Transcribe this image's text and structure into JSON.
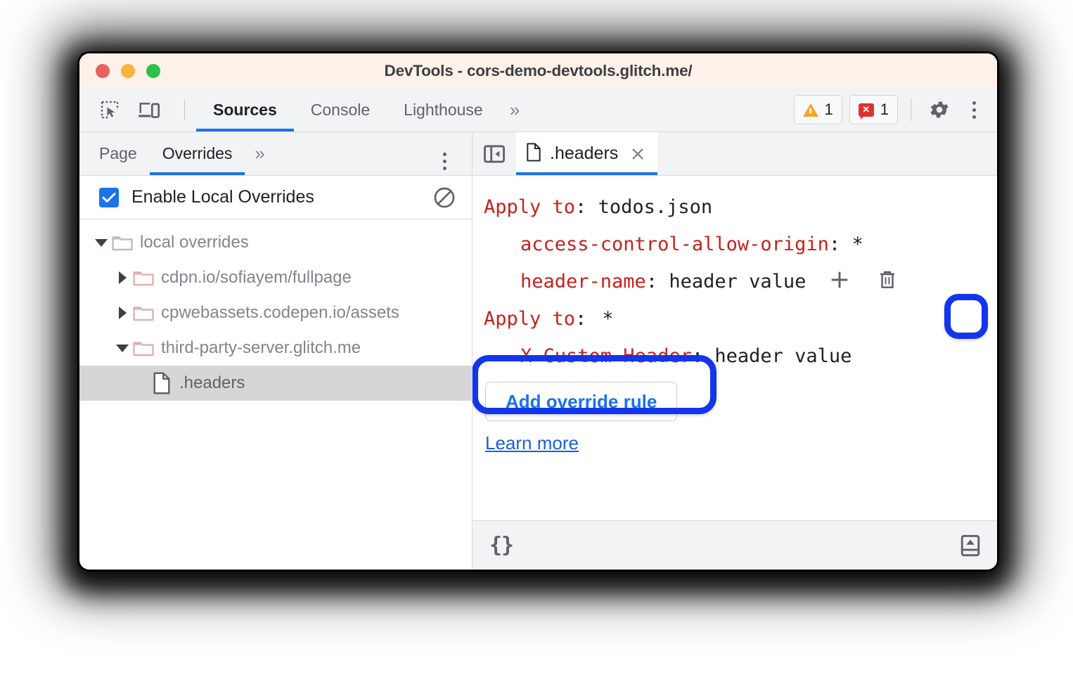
{
  "window": {
    "title": "DevTools - cors-demo-devtools.glitch.me/",
    "traffic_lights": [
      "close",
      "minimize",
      "maximize"
    ],
    "accent": "#1a73e8",
    "annotation_color": "#1335ec",
    "titlebar_color": "#fdf1e9"
  },
  "toolbar": {
    "icons": [
      "inspect-element-icon",
      "device-toolbar-icon"
    ],
    "tabs": [
      {
        "label": "Sources",
        "active": true
      },
      {
        "label": "Console",
        "active": false
      },
      {
        "label": "Lighthouse",
        "active": false
      }
    ],
    "more_tabs": "»",
    "warnings": {
      "icon": "warning-triangle-icon",
      "count": "1",
      "color": "#f5a623"
    },
    "errors": {
      "icon": "error-badge-icon",
      "count": "1",
      "color": "#e03131"
    },
    "settings_icon": "gear-icon",
    "more_icon": "kebab-menu-icon"
  },
  "sidebar": {
    "tabs": [
      {
        "label": "Page",
        "active": false
      },
      {
        "label": "Overrides",
        "active": true
      }
    ],
    "more_tabs": "»",
    "more_icon": "kebab-menu-icon",
    "enable_overrides": {
      "label": "Enable Local Overrides",
      "checked": true,
      "clear_icon": "clear-configuration-icon"
    },
    "tree": [
      {
        "label": "local overrides",
        "type": "folder",
        "depth": 0,
        "expanded": true,
        "selected": false
      },
      {
        "label": "cdpn.io/sofiayem/fullpage",
        "type": "folder",
        "depth": 1,
        "expanded": false,
        "selected": false
      },
      {
        "label": "cpwebassets.codepen.io/assets",
        "type": "folder",
        "depth": 1,
        "expanded": false,
        "selected": false
      },
      {
        "label": "third-party-server.glitch.me",
        "type": "folder",
        "depth": 1,
        "expanded": true,
        "selected": false
      },
      {
        "label": ".headers",
        "type": "file",
        "depth": 2,
        "expanded": null,
        "selected": true
      }
    ]
  },
  "editor": {
    "panel_toggle_icon": "show-navigator-icon",
    "tab": {
      "icon": "file-icon",
      "name": ".headers",
      "close_icon": "close-icon",
      "active": true
    },
    "rules": [
      {
        "apply_label": "Apply to",
        "colon": ":",
        "pattern": "todos.json",
        "headers": [
          {
            "name": "access-control-allow-origin",
            "colon": ":",
            "value": "*",
            "actions": false
          },
          {
            "name": "header-name",
            "colon": ":",
            "value": "header value",
            "actions": true
          }
        ]
      },
      {
        "apply_label": "Apply to",
        "colon": ":",
        "pattern": "*",
        "headers": [
          {
            "name": "X-Custom-Header",
            "colon": ":",
            "value": "header value",
            "actions": false
          }
        ]
      }
    ],
    "row_actions": {
      "add_icon": "plus-icon",
      "delete_icon": "trash-icon"
    },
    "add_override_button": "Add override rule",
    "learn_more_link": "Learn more"
  },
  "statusbar": {
    "pretty_print_label": "{}",
    "pretty_print_icon": "format-braces-icon",
    "drawer_icon": "show-drawer-icon"
  },
  "annotations": [
    {
      "name": "row-actions-highlight",
      "target": "plus-and-trash-buttons"
    },
    {
      "name": "apply-to-pattern-highlight",
      "target": "wildcard-pattern"
    },
    {
      "name": "add-override-rule-highlight",
      "target": "add-override-rule-button"
    }
  ]
}
